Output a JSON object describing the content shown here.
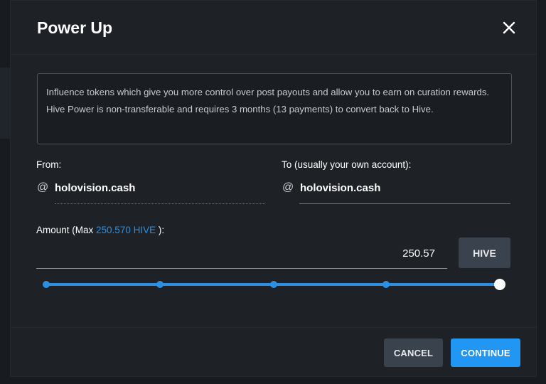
{
  "modal": {
    "title": "Power Up",
    "close_icon": "close-icon"
  },
  "info": {
    "line1": "Influence tokens which give you more control over post payouts and allow you to earn on curation rewards.",
    "line2": "Hive Power is non-transferable and requires 3 months (13 payments) to convert back to Hive."
  },
  "from": {
    "label": "From:",
    "at": "@",
    "account": "holovision.cash"
  },
  "to": {
    "label": "To (usually your own account):",
    "at": "@",
    "account": "holovision.cash"
  },
  "amount": {
    "label_prefix": "Amount (Max ",
    "max_value": "250.570 HIVE",
    "label_suffix": " ):",
    "value": "250.57",
    "currency_button": "HIVE",
    "slider_percent": 100
  },
  "footer": {
    "cancel_label": "CANCEL",
    "continue_label": "CONTINUE"
  },
  "colors": {
    "accent": "#2196f3",
    "link": "#2d8fe0",
    "modal_bg": "#1e2227"
  }
}
